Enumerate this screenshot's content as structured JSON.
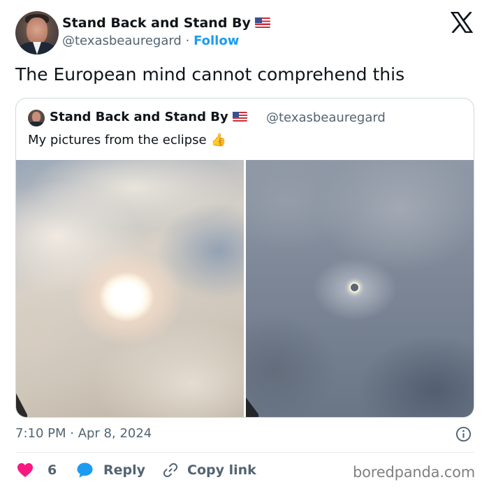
{
  "author": {
    "name": "Stand Back and Stand By",
    "handle": "@texasbeauregard",
    "separator": "·",
    "follow_label": "Follow"
  },
  "tweet": {
    "text": "The European mind cannot comprehend this",
    "timestamp": "7:10 PM · Apr 8, 2024"
  },
  "quoted_tweet": {
    "name": "Stand Back and Stand By",
    "handle": "@texasbeauregard",
    "text": "My pictures from the eclipse",
    "emoji": "👍"
  },
  "actions": {
    "like_count": "6",
    "reply_label": "Reply",
    "copy_link_label": "Copy link"
  },
  "watermark": "boredpanda.com",
  "icons": [
    "x-logo-icon",
    "us-flag-icon",
    "thumbs-up-icon",
    "info-icon",
    "heart-icon",
    "reply-bubble-icon",
    "link-icon"
  ],
  "colors": {
    "accent": "#1d9bf0",
    "heart": "#f91880",
    "secondary_text": "#536471",
    "primary_text": "#0f1419",
    "border": "#cfd9de"
  }
}
